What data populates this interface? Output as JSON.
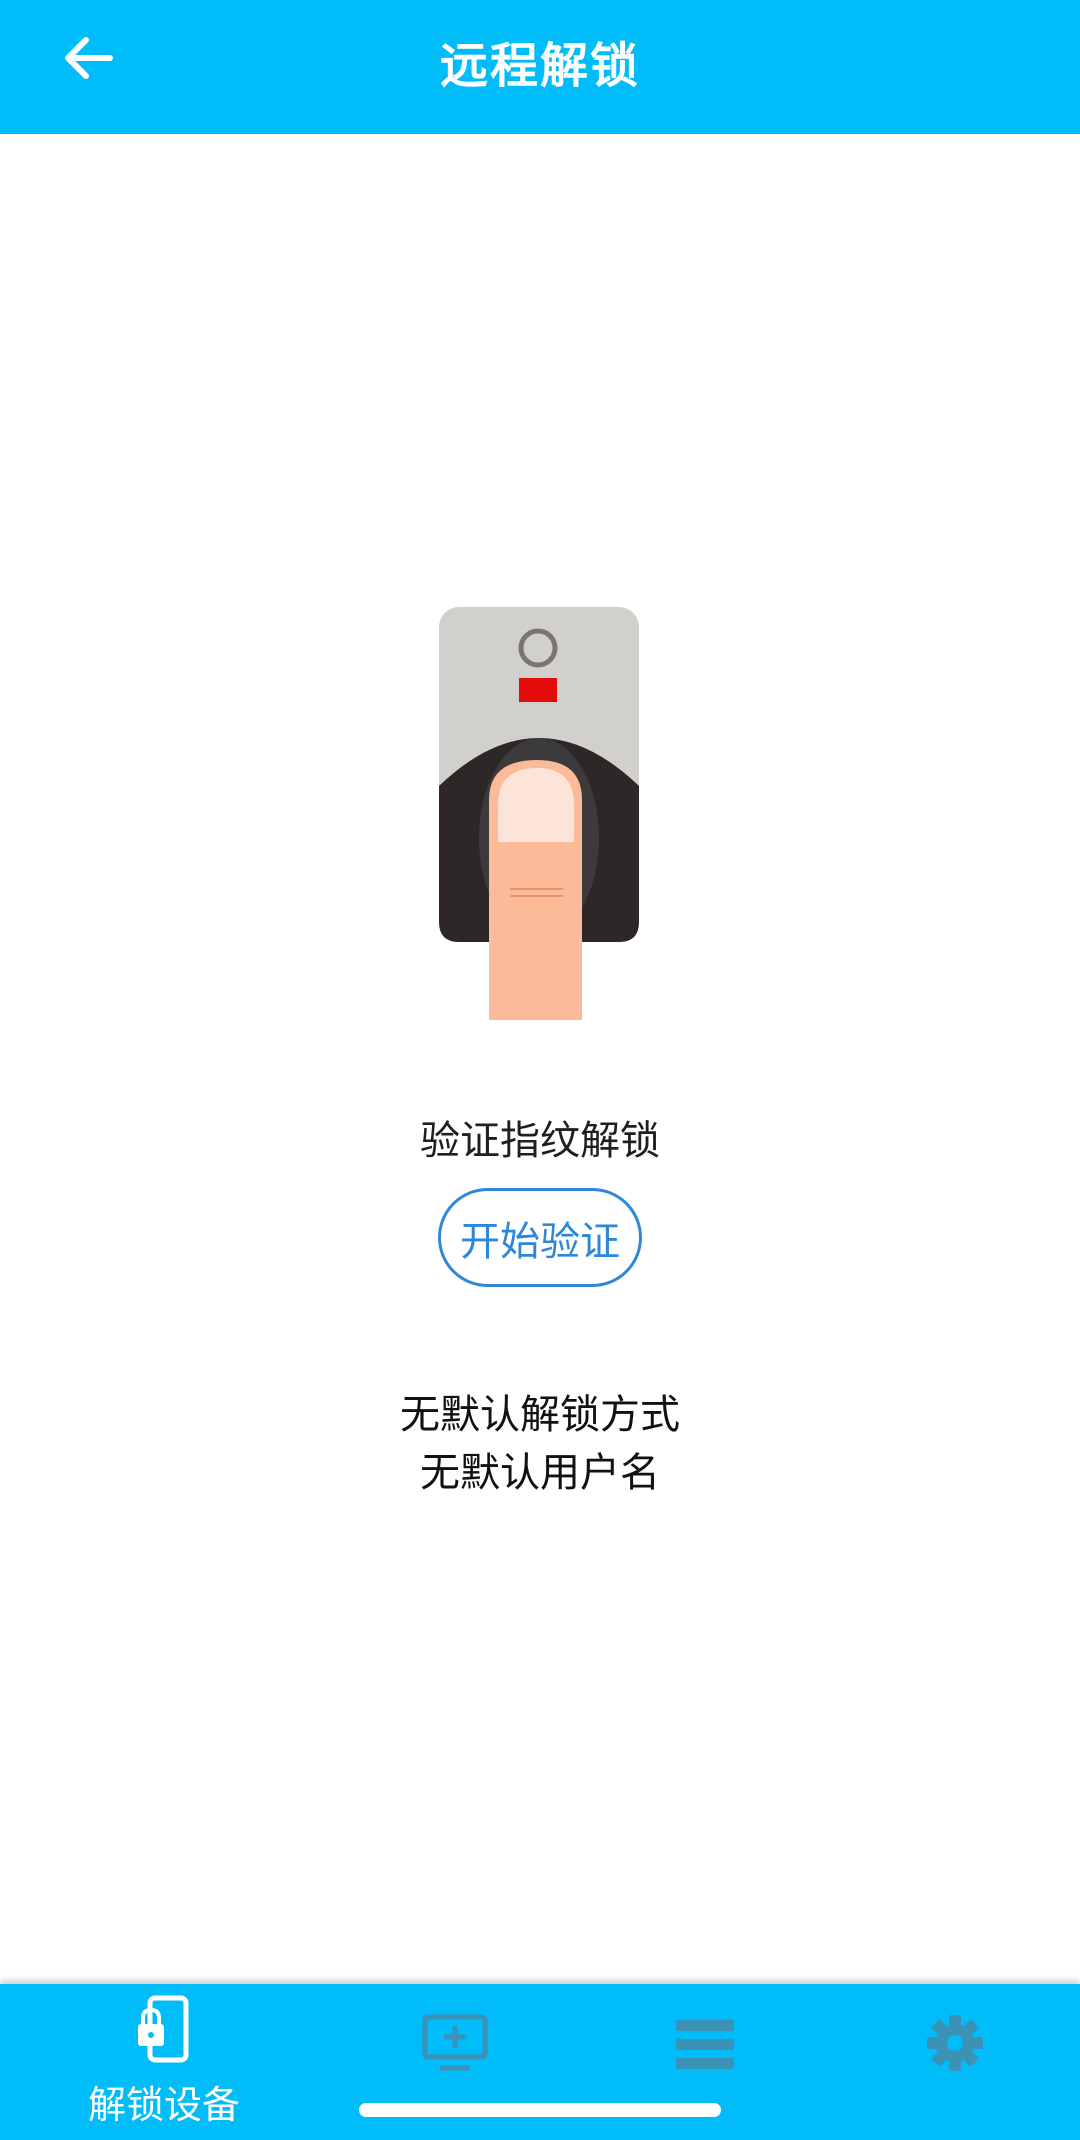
{
  "header": {
    "title": "远程解锁",
    "back_icon": "arrow-left-icon"
  },
  "main": {
    "illustration_icon": "fingerprint-scanner-icon",
    "verify_label": "验证指纹解锁",
    "start_button_label": "开始验证",
    "info_lines": [
      "无默认解锁方式",
      "无默认用户名"
    ]
  },
  "bottom_nav": {
    "items": [
      {
        "label": "解锁设备",
        "icon": "phone-lock-icon",
        "active": true
      },
      {
        "label": "",
        "icon": "monitor-add-icon",
        "active": false
      },
      {
        "label": "",
        "icon": "list-icon",
        "active": false
      },
      {
        "label": "",
        "icon": "gear-icon",
        "active": false
      }
    ]
  },
  "colors": {
    "primary": "#00bcf9",
    "button_accent": "#2e87d9",
    "inactive_icon": "#3c91b6"
  }
}
